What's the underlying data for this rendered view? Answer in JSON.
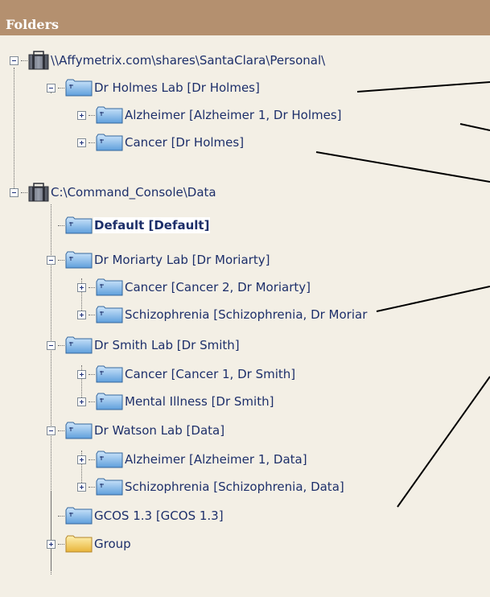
{
  "header": {
    "title": "Folders"
  },
  "tree": {
    "rows": [
      {
        "label": "\\\\Affymetrix.com\\shares\\SantaClara\\Personal\\"
      },
      {
        "label": "Dr Holmes Lab [Dr Holmes]"
      },
      {
        "label": "Alzheimer [Alzheimer 1, Dr Holmes]"
      },
      {
        "label": "Cancer [Dr Holmes]"
      },
      {
        "label": "C:\\Command_Console\\Data"
      },
      {
        "label": "Default [Default]"
      },
      {
        "label": "Dr Moriarty Lab [Dr Moriarty]"
      },
      {
        "label": "Cancer [Cancer 2, Dr Moriarty]"
      },
      {
        "label": "Schizophrenia [Schizophrenia, Dr Moriar"
      },
      {
        "label": "Dr Smith Lab [Dr Smith]"
      },
      {
        "label": "Cancer [Cancer 1, Dr Smith]"
      },
      {
        "label": "Mental Illness [Dr Smith]"
      },
      {
        "label": "Dr Watson Lab [Data]"
      },
      {
        "label": "Alzheimer [Alzheimer 1, Data]"
      },
      {
        "label": "Schizophrenia [Schizophrenia, Data]"
      },
      {
        "label": "GCOS 1.3 [GCOS 1.3]"
      },
      {
        "label": "Group"
      }
    ]
  },
  "colors": {
    "header_bg": "#b4906f",
    "panel_bg": "#f3efe5",
    "label_text": "#1d2f6a",
    "folder_blue": "#5f9fdc",
    "folder_yellow": "#f0c64a"
  }
}
